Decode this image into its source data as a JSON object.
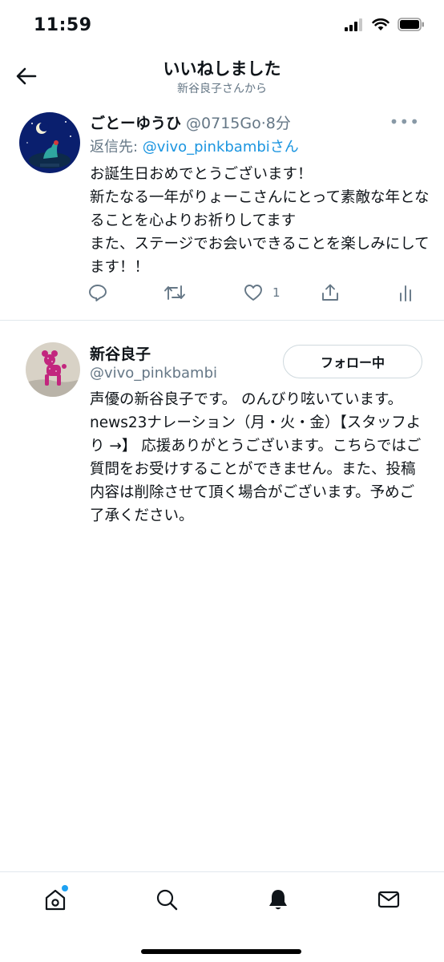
{
  "status_bar": {
    "time": "11:59"
  },
  "header": {
    "title": "いいねしました",
    "subtitle": "新谷良子さんから"
  },
  "tweet": {
    "author_name": "ごとーゆうひ",
    "author_handle": "@0715Go",
    "time": "·8分",
    "reply_prefix": "返信先: ",
    "reply_handle": "@vivo_pinkbambi",
    "reply_suffix": "さん",
    "body": "お誕生日おめでとうございます！\n新たなる一年がりょーこさんにとって素敵な年となることを心よりお祈りしてます\nまた、ステージでお会いできることを楽しみにしてます！！",
    "like_count": "1"
  },
  "profile": {
    "name": "新谷良子",
    "handle": "@vivo_pinkbambi",
    "follow_label": "フォロー中",
    "bio": "声優の新谷良子です。 のんびり呟いています。news23ナレーション（月・火・金）【スタッフより →】 応援ありがとうございます。こちらではご質問をお受けすることができません。また、投稿内容は削除させて頂く場合がございます。予めご了承ください。"
  },
  "tabbar": {
    "tabs": [
      {
        "icon": "home-icon"
      },
      {
        "icon": "search-icon"
      },
      {
        "icon": "notifications-bell-icon"
      },
      {
        "icon": "messages-envelope-icon"
      }
    ]
  },
  "colors": {
    "accent": "#1da1f2",
    "link": "#1b95e0",
    "secondary_text": "#657786",
    "divider": "#e1e8ed"
  }
}
